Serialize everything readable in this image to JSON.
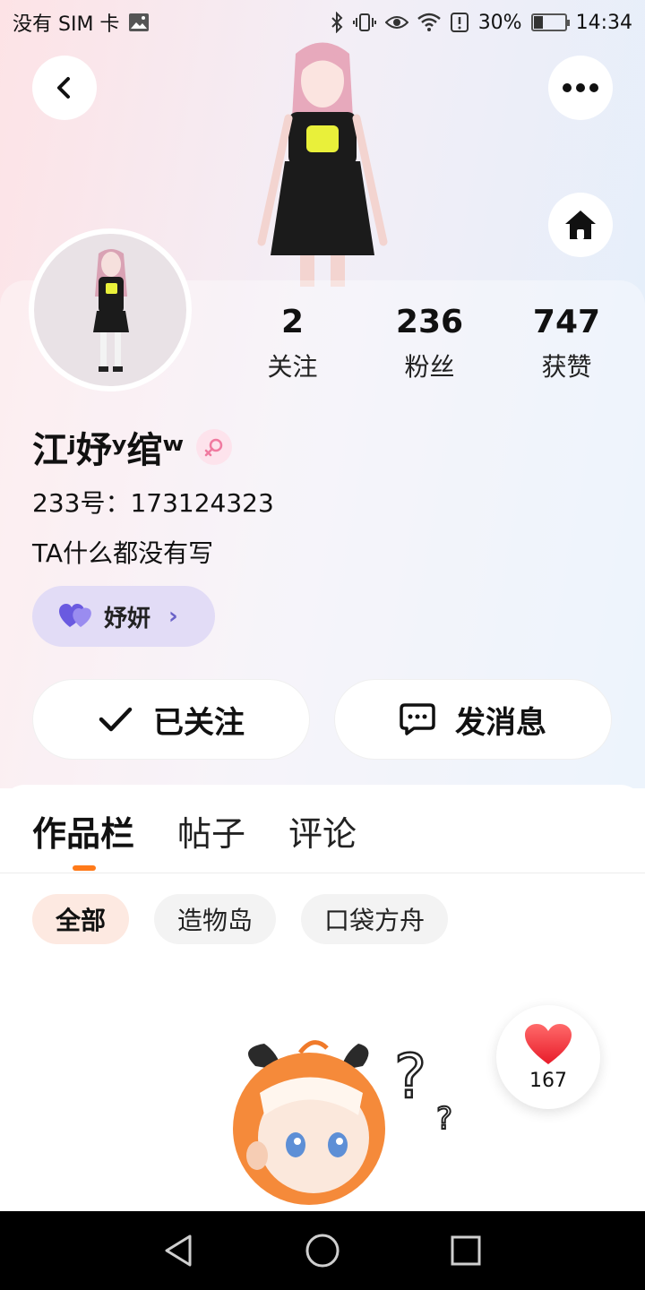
{
  "status_bar": {
    "carrier": "没有 SIM 卡",
    "battery": "30%",
    "time": "14:34"
  },
  "icons": {
    "back": "chevron-left-icon",
    "more": "more-dots-icon",
    "home": "home-icon",
    "gender": "female-gender-icon",
    "cp": "heart-icon",
    "check": "check-icon",
    "message": "chat-bubble-icon",
    "like": "heart-icon"
  },
  "stats": [
    {
      "value": "2",
      "label": "关注"
    },
    {
      "value": "236",
      "label": "粉丝"
    },
    {
      "value": "747",
      "label": "获赞"
    }
  ],
  "profile": {
    "username": "江ʲ妤ʸ绾ʷ",
    "uid": "233号：173124323",
    "bio": "TA什么都没有写",
    "cp_tag": "妤妍"
  },
  "actions": {
    "follow_label": "已关注",
    "message_label": "发消息"
  },
  "tabs": [
    "作品栏",
    "帖子",
    "评论"
  ],
  "chips": [
    "全部",
    "造物岛",
    "口袋方舟"
  ],
  "like_count": "167",
  "colors": {
    "accent": "#ff7a1a",
    "cp_tag_bg": "#e2dcf6",
    "like_red": "#ff3b3b"
  }
}
